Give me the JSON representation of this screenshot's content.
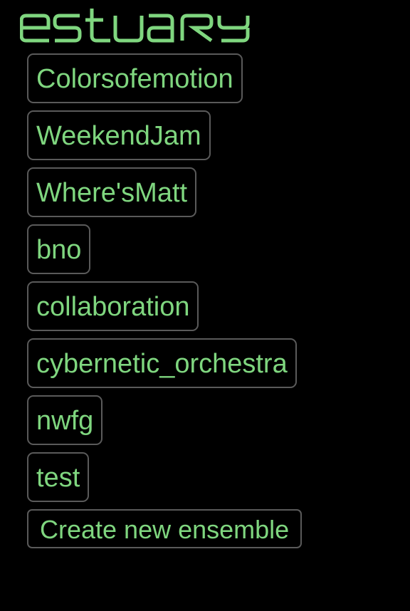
{
  "app": {
    "logo_text": "estuary",
    "accent_color": "#7fd67f",
    "border_color": "#5a5a5a",
    "background_color": "#000000"
  },
  "ensembles": [
    {
      "label": "Colorsofemotion"
    },
    {
      "label": "WeekendJam"
    },
    {
      "label": "Where'sMatt"
    },
    {
      "label": "bno"
    },
    {
      "label": "collaboration"
    },
    {
      "label": "cybernetic_orchestra"
    },
    {
      "label": "nwfg"
    },
    {
      "label": "test"
    }
  ],
  "create_button": {
    "label": "Create new ensemble"
  }
}
